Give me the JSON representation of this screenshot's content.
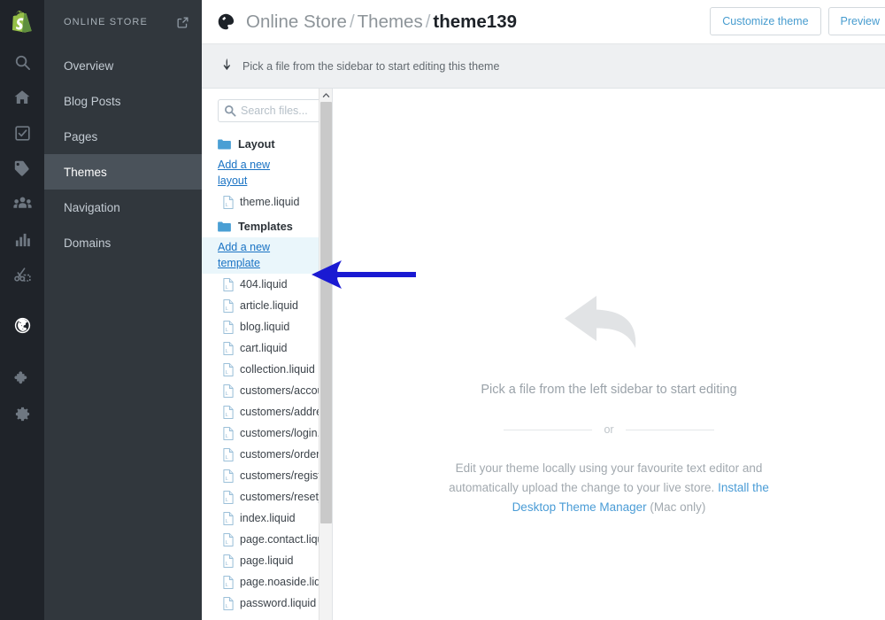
{
  "rail": {
    "logo": "shopify-logo",
    "icons": [
      {
        "name": "search-icon",
        "label": "Search",
        "active": false
      },
      {
        "name": "home-icon",
        "label": "Home",
        "active": false
      },
      {
        "name": "orders-icon",
        "label": "Orders",
        "active": false
      },
      {
        "name": "products-tag-icon",
        "label": "Products",
        "active": false
      },
      {
        "name": "customers-icon",
        "label": "Customers",
        "active": false
      },
      {
        "name": "analytics-bar-icon",
        "label": "Analytics",
        "active": false
      },
      {
        "name": "discounts-scissors-icon",
        "label": "Discounts",
        "active": false
      },
      {
        "name": "online-store-globe-icon",
        "label": "Online Store",
        "active": true
      },
      {
        "name": "apps-puzzle-icon",
        "label": "Apps",
        "active": false
      },
      {
        "name": "settings-gear-icon",
        "label": "Settings",
        "active": false
      }
    ]
  },
  "sidebar": {
    "title": "ONLINE STORE",
    "external_link_icon": "external-link-icon",
    "items": [
      {
        "label": "Overview",
        "active": false
      },
      {
        "label": "Blog Posts",
        "active": false
      },
      {
        "label": "Pages",
        "active": false
      },
      {
        "label": "Themes",
        "active": true
      },
      {
        "label": "Navigation",
        "active": false
      },
      {
        "label": "Domains",
        "active": false
      }
    ]
  },
  "topbar": {
    "icon": "paint-palette-icon",
    "crumb1": "Online Store",
    "sep1": "/",
    "crumb2": "Themes",
    "sep2": "/",
    "current": "theme139",
    "customize_label": "Customize theme",
    "preview_label": "Preview"
  },
  "notice": {
    "icon": "curved-arrow-icon",
    "text": "Pick a file from the sidebar to start editing this theme"
  },
  "files": {
    "search_placeholder": "Search files...",
    "search_value": "",
    "search_icon": "search-icon",
    "groups": [
      {
        "name": "Layout",
        "folder_icon": "folder-icon",
        "add_label": "Add a new layout",
        "add_highlighted": false,
        "items": [
          {
            "label": "theme.liquid"
          }
        ]
      },
      {
        "name": "Templates",
        "folder_icon": "folder-icon",
        "add_label": "Add a new template",
        "add_highlighted": true,
        "items": [
          {
            "label": "404.liquid"
          },
          {
            "label": "article.liquid"
          },
          {
            "label": "blog.liquid"
          },
          {
            "label": "cart.liquid"
          },
          {
            "label": "collection.liquid"
          },
          {
            "label": "customers/account.liquid"
          },
          {
            "label": "customers/addresses.liquid"
          },
          {
            "label": "customers/login.liquid"
          },
          {
            "label": "customers/order.liquid"
          },
          {
            "label": "customers/register.liquid"
          },
          {
            "label": "customers/reset_password.liquid"
          },
          {
            "label": "index.liquid"
          },
          {
            "label": "page.contact.liquid"
          },
          {
            "label": "page.liquid"
          },
          {
            "label": "page.noaside.liquid"
          },
          {
            "label": "password.liquid"
          }
        ]
      }
    ]
  },
  "empty_state": {
    "arrow_icon": "back-arrow-icon",
    "title": "Pick a file from the left sidebar to start editing",
    "or": "or",
    "desc_before": "Edit your theme locally using your favourite text editor and automatically upload the change to your live store. ",
    "link": "Install the Desktop Theme Manager",
    "desc_after": " (Mac only)"
  },
  "annotation": {
    "name": "blue-pointer-arrow",
    "color": "#1a1ad2",
    "points_to": "Add a new template"
  },
  "colors": {
    "rail_bg": "#1f2329",
    "nav_bg": "#31373d",
    "nav_active_bg": "#4a525a",
    "shopify_green": "#95bf47",
    "link_blue": "#1a73c4",
    "button_blue": "#479ccf",
    "notice_bg": "#eef0f2"
  }
}
